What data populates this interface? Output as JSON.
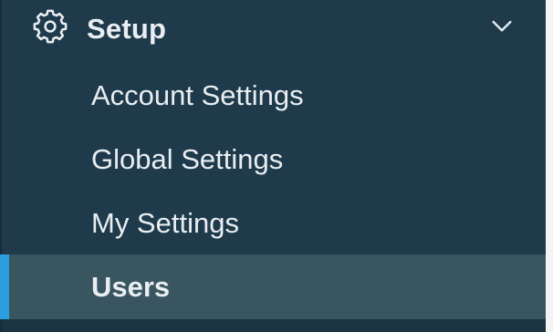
{
  "section": {
    "title": "Setup",
    "icon": "gear-icon",
    "expand_icon": "chevron-down-icon",
    "expanded": true
  },
  "menu": {
    "items": [
      {
        "label": "Account Settings",
        "active": false
      },
      {
        "label": "Global Settings",
        "active": false
      },
      {
        "label": "My Settings",
        "active": false
      },
      {
        "label": "Users",
        "active": true
      }
    ]
  },
  "colors": {
    "sidebar_bg": "#1f3a4a",
    "active_item_bg": "#385560",
    "active_indicator": "#2d9fe0",
    "text": "#e8eef2"
  }
}
